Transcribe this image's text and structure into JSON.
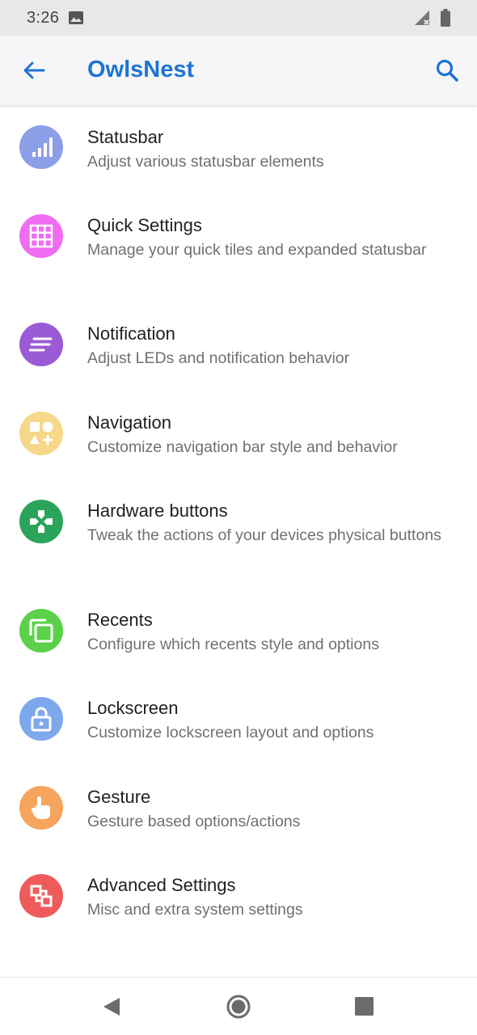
{
  "status_bar": {
    "time": "3:26",
    "icons": [
      "image-icon",
      "signal-icon",
      "battery-icon"
    ]
  },
  "app_bar": {
    "title": "OwlsNest",
    "back_icon": "arrow-left-icon",
    "search_icon": "search-icon",
    "accent_color": "#1e73d6"
  },
  "items": [
    {
      "title": "Statusbar",
      "summary": "Adjust various statusbar elements",
      "icon": "signal-bars-icon",
      "color": "#8d9ee8"
    },
    {
      "title": "Quick Settings",
      "summary": "Manage your quick tiles and expanded statusbar",
      "icon": "grid-icon",
      "color": "#f06cf0"
    },
    {
      "title": "Notification",
      "summary": "Adjust LEDs and notification behavior",
      "icon": "notes-lines-icon",
      "color": "#9b5bd6"
    },
    {
      "title": "Navigation",
      "summary": "Customize navigation bar style and behavior",
      "icon": "shapes-icon",
      "color": "#f5d88a"
    },
    {
      "title": "Hardware buttons",
      "summary": "Tweak the actions of your devices physical buttons",
      "icon": "gamepad-icon",
      "color": "#2aa45a"
    },
    {
      "title": "Recents",
      "summary": "Configure which recents style and options",
      "icon": "copy-squares-icon",
      "color": "#5cd04a"
    },
    {
      "title": "Lockscreen",
      "summary": "Customize lockscreen layout and options",
      "icon": "lock-icon",
      "color": "#7ea8ec"
    },
    {
      "title": "Gesture",
      "summary": "Gesture based options/actions",
      "icon": "hand-pointer-icon",
      "color": "#f7a45c"
    },
    {
      "title": "Advanced Settings",
      "summary": "Misc and extra system settings",
      "icon": "nodes-icon",
      "color": "#ef5b5b"
    }
  ],
  "nav_bar": {
    "icons": [
      "nav-back-icon",
      "nav-home-icon",
      "nav-recents-icon"
    ]
  }
}
